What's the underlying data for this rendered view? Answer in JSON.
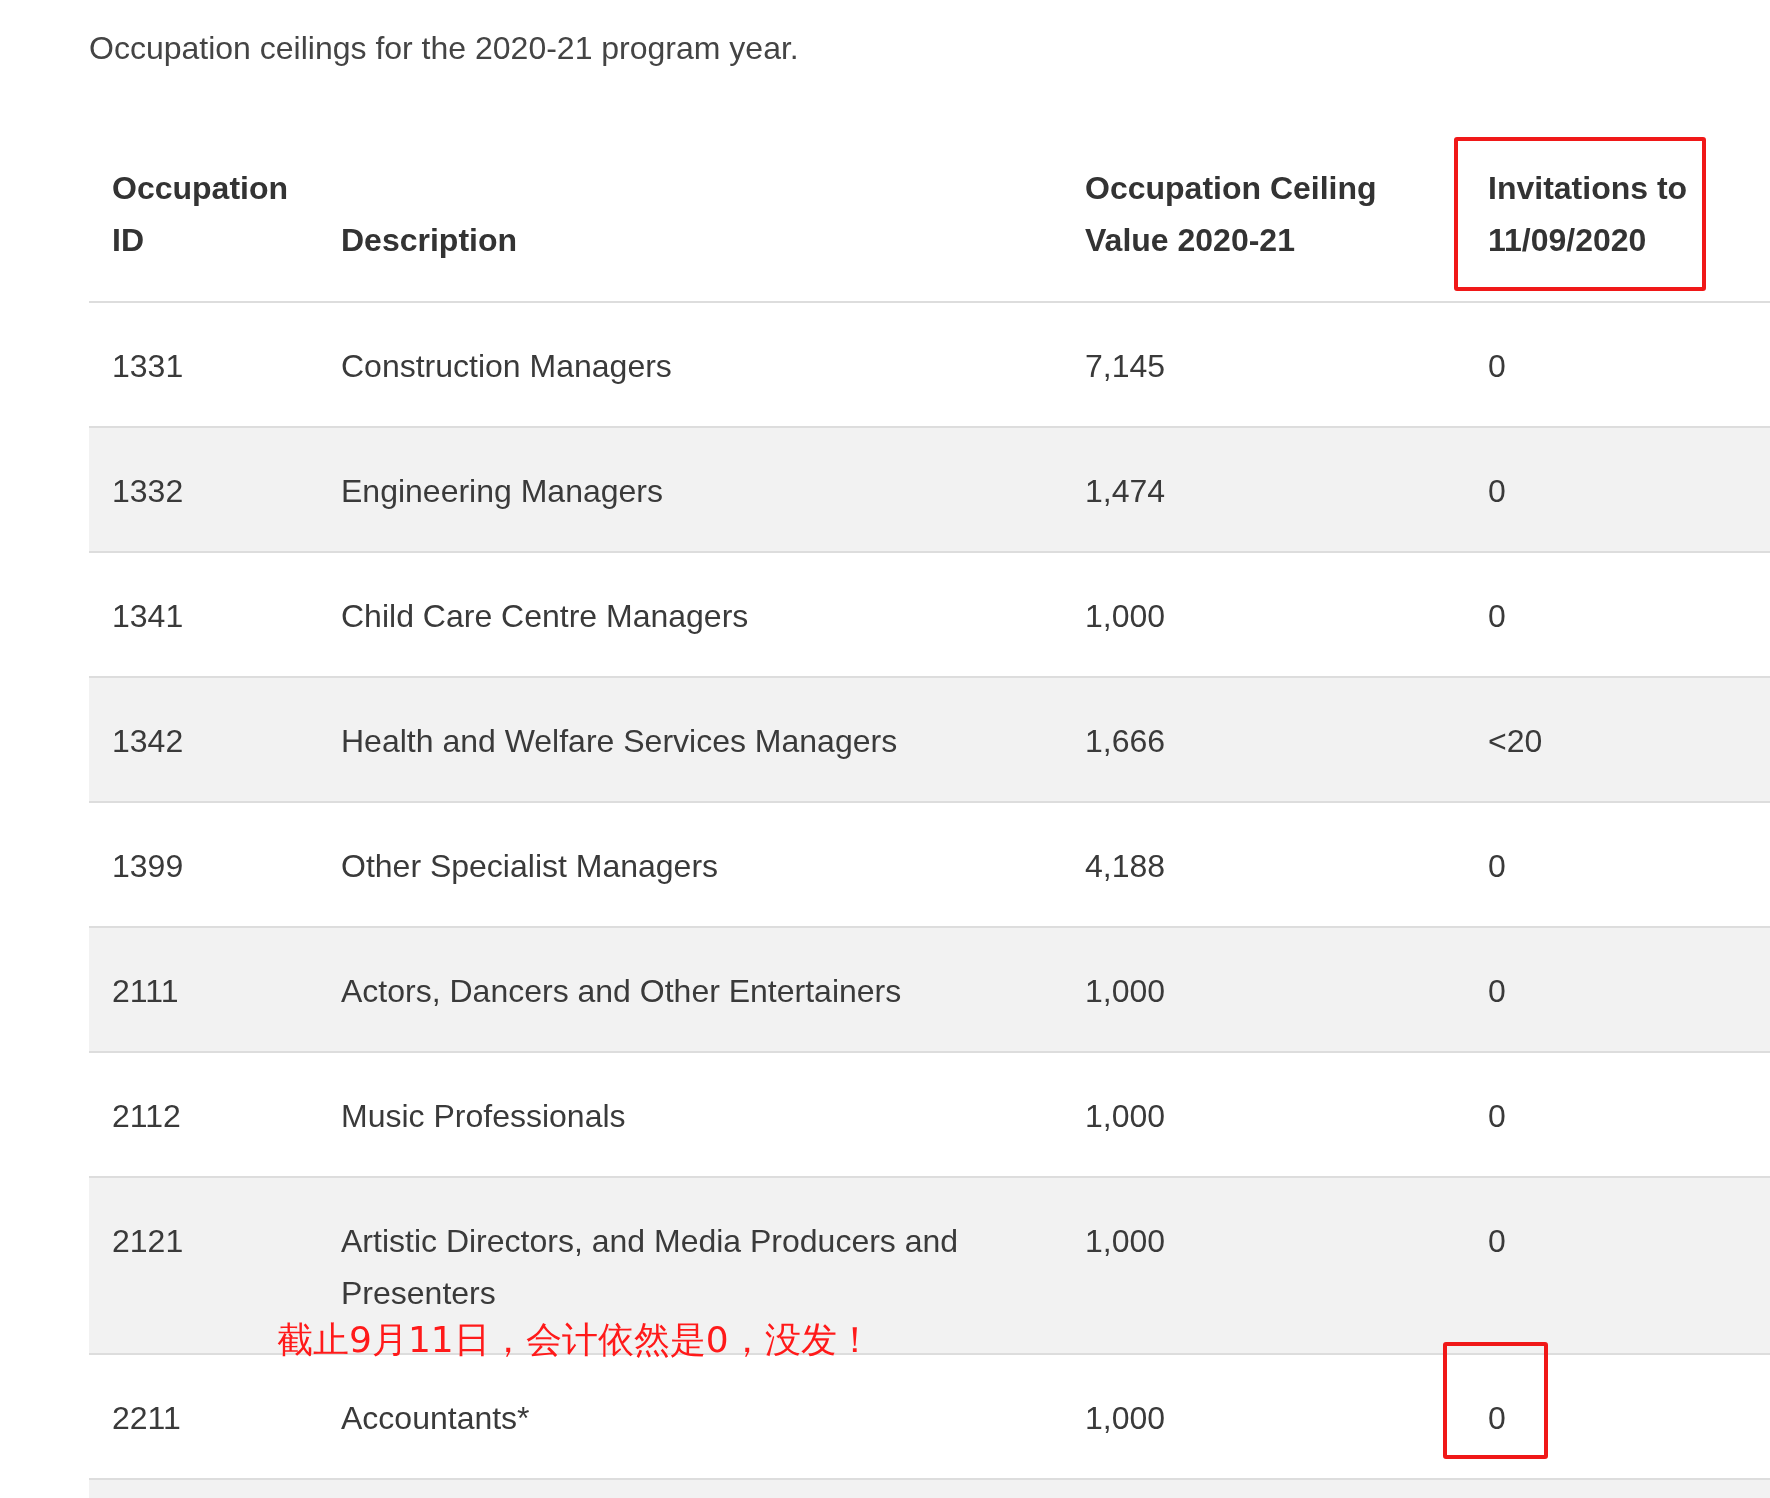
{
  "intro": "Occupation ceilings for the 2020-21 program year.",
  "table": {
    "columns": [
      "Occupation ID",
      "Description",
      "Occupation Ceiling Value 2020-21",
      "Invitations to 11/09/2020"
    ],
    "rows": [
      [
        "1331",
        "Construction Managers",
        "7,145",
        "0"
      ],
      [
        "1332",
        "Engineering Managers",
        "1,474",
        "0"
      ],
      [
        "1341",
        "Child Care Centre Managers",
        "1,000",
        "0"
      ],
      [
        "1342",
        "Health and Welfare Services Managers",
        "1,666",
        "<20"
      ],
      [
        "1399",
        "Other Specialist Managers",
        "4,188",
        "0"
      ],
      [
        "2111",
        "Actors, Dancers and Other Entertainers",
        "1,000",
        "0"
      ],
      [
        "2112",
        "Music Professionals",
        "1,000",
        "0"
      ],
      [
        "2121",
        "Artistic Directors, and Media Producers and Presenters",
        "1,000",
        "0"
      ],
      [
        "2211",
        "Accountants*",
        "1,000",
        "0"
      ]
    ]
  },
  "annotation": {
    "note": "截止9月11日，会计依然是0，没发！"
  }
}
